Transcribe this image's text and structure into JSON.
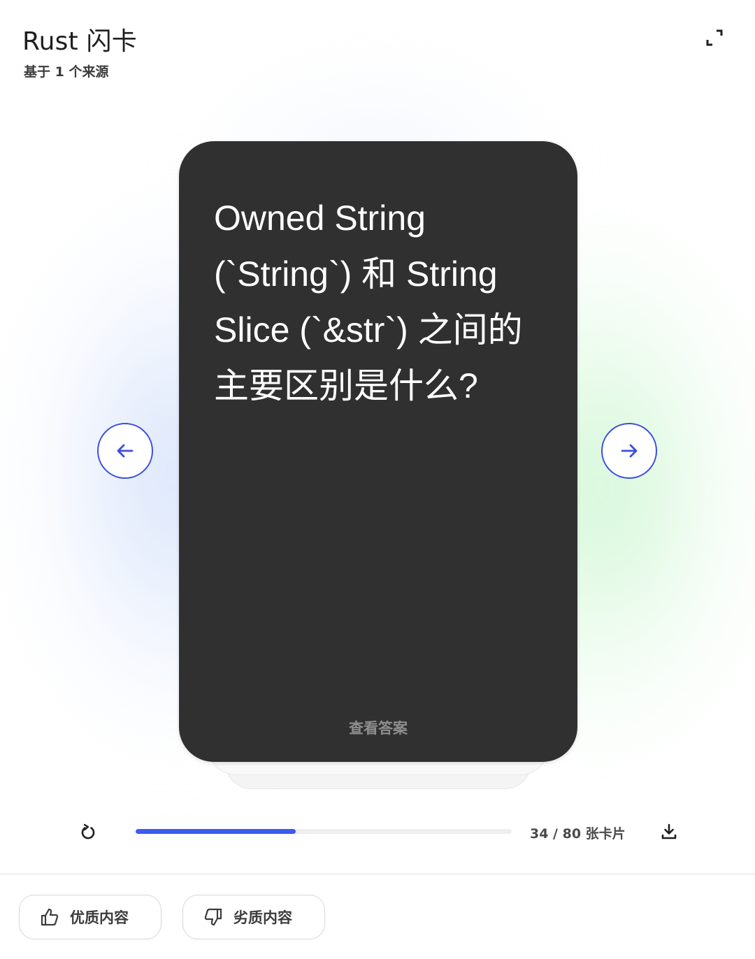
{
  "header": {
    "title": "Rust 闪卡",
    "subtitle": "基于 1 个来源",
    "expand_icon": "expand-icon"
  },
  "card": {
    "question": "Owned String (`String`) 和 String Slice (`&str`) 之间的主要区别是什么?",
    "reveal_label": "查看答案"
  },
  "navigation": {
    "prev_icon": "arrow-left-icon",
    "next_icon": "arrow-right-icon"
  },
  "progress": {
    "current": 34,
    "total": 80,
    "fraction": 0.425,
    "label": "34 / 80 张卡片",
    "restart_icon": "restart-icon",
    "download_icon": "download-icon"
  },
  "feedback": {
    "good_label": "优质内容",
    "bad_label": "劣质内容"
  },
  "colors": {
    "accent": "#3b5bf0",
    "card_background": "#303030"
  }
}
